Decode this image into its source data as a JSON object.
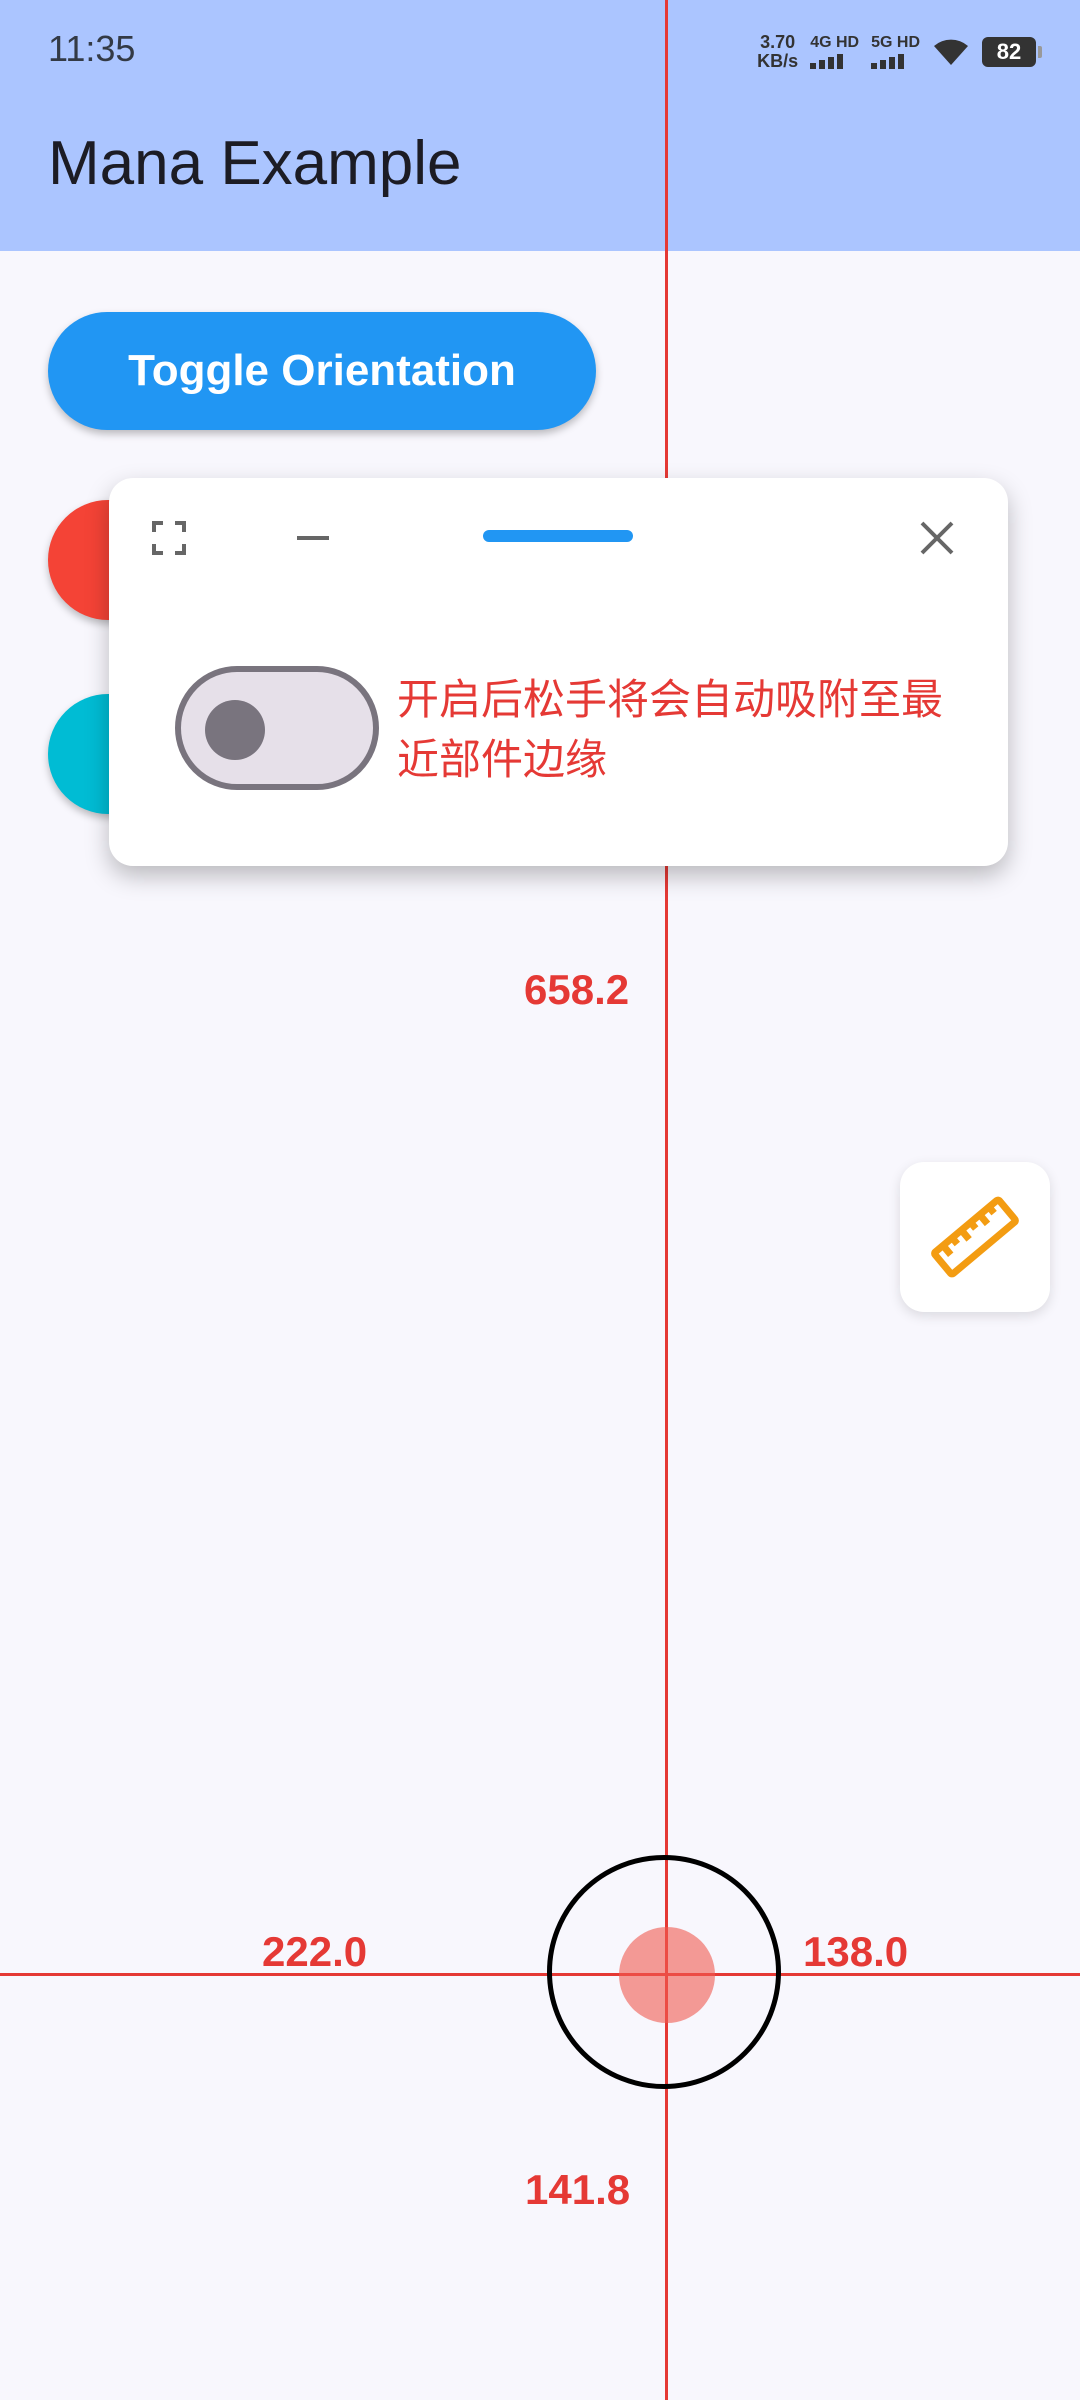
{
  "status_bar": {
    "time": "11:35",
    "net_speed_value": "3.70",
    "net_speed_unit": "KB/s",
    "sim1": "4G HD",
    "sim2": "5G HD",
    "battery": "82"
  },
  "app_bar": {
    "title": "Mana Example"
  },
  "main": {
    "toggle_orientation_label": "Toggle Orientation"
  },
  "panel": {
    "snap_switch_label": "开启后松手将会自动吸附至最近部件边缘",
    "snap_switch_on": false
  },
  "measurements": {
    "top": "658.2",
    "left": "222.0",
    "right": "138.0",
    "bottom": "141.8"
  },
  "colors": {
    "app_bar": "#abc5ff",
    "primary": "#2196f3",
    "guide_line": "#e53935",
    "ruler_icon": "#f39c12",
    "fab_red": "#f44336",
    "fab_cyan": "#00bcd4"
  },
  "icons": {
    "panel_fullscreen": "fullscreen-icon",
    "panel_minimize": "minimize-icon",
    "panel_close": "close-icon",
    "ruler": "ruler-icon"
  }
}
